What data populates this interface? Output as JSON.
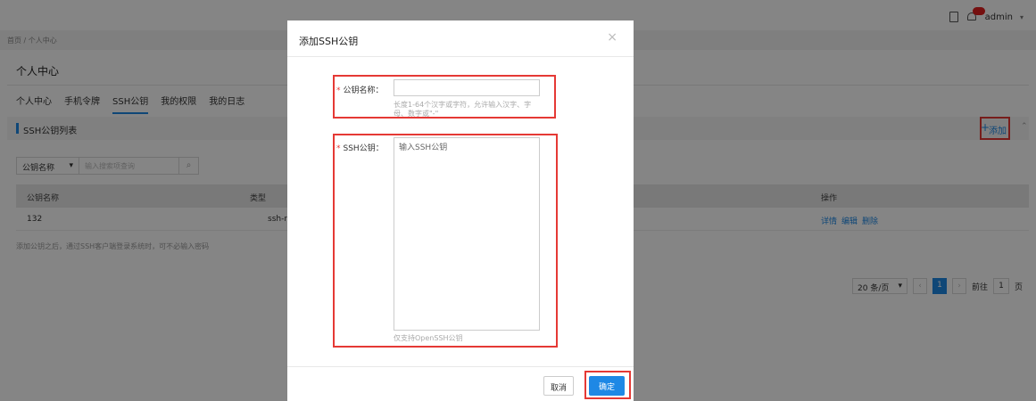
{
  "topbar": {
    "user": "admin"
  },
  "breadcrumb": "首页 / 个人中心",
  "page_title": "个人中心",
  "tabs": [
    "个人中心",
    "手机令牌",
    "SSH公钥",
    "我的权限",
    "我的日志"
  ],
  "section": {
    "title": "SSH公钥列表",
    "add_label": "添加"
  },
  "filter": {
    "field": "公钥名称",
    "placeholder": "输入搜索项查询"
  },
  "table": {
    "headers": [
      "公钥名称",
      "类型",
      "操作"
    ],
    "rows": [
      {
        "name": "132",
        "type": "ssh-rs",
        "actions": [
          "详情",
          "编辑",
          "删除"
        ]
      }
    ]
  },
  "note": "添加公钥之后，通过SSH客户端登录系统时，可不必输入密码",
  "pager": {
    "size": "20 条/页",
    "current": "1",
    "goto_label": "前往",
    "goto_value": "1",
    "page_unit": "页"
  },
  "modal": {
    "title": "添加SSH公钥",
    "name_label": "公钥名称：",
    "name_hint": "长度1-64个汉字或字符，允许输入汉字、字母、数字或\"-\"",
    "key_label": "SSH公钥：",
    "key_placeholder": "输入SSH公钥",
    "key_hint": "仅支持OpenSSH公钥",
    "cancel": "取消",
    "ok": "确定"
  },
  "colors": {
    "accent": "#1e88e5",
    "highlight": "#e53935"
  }
}
